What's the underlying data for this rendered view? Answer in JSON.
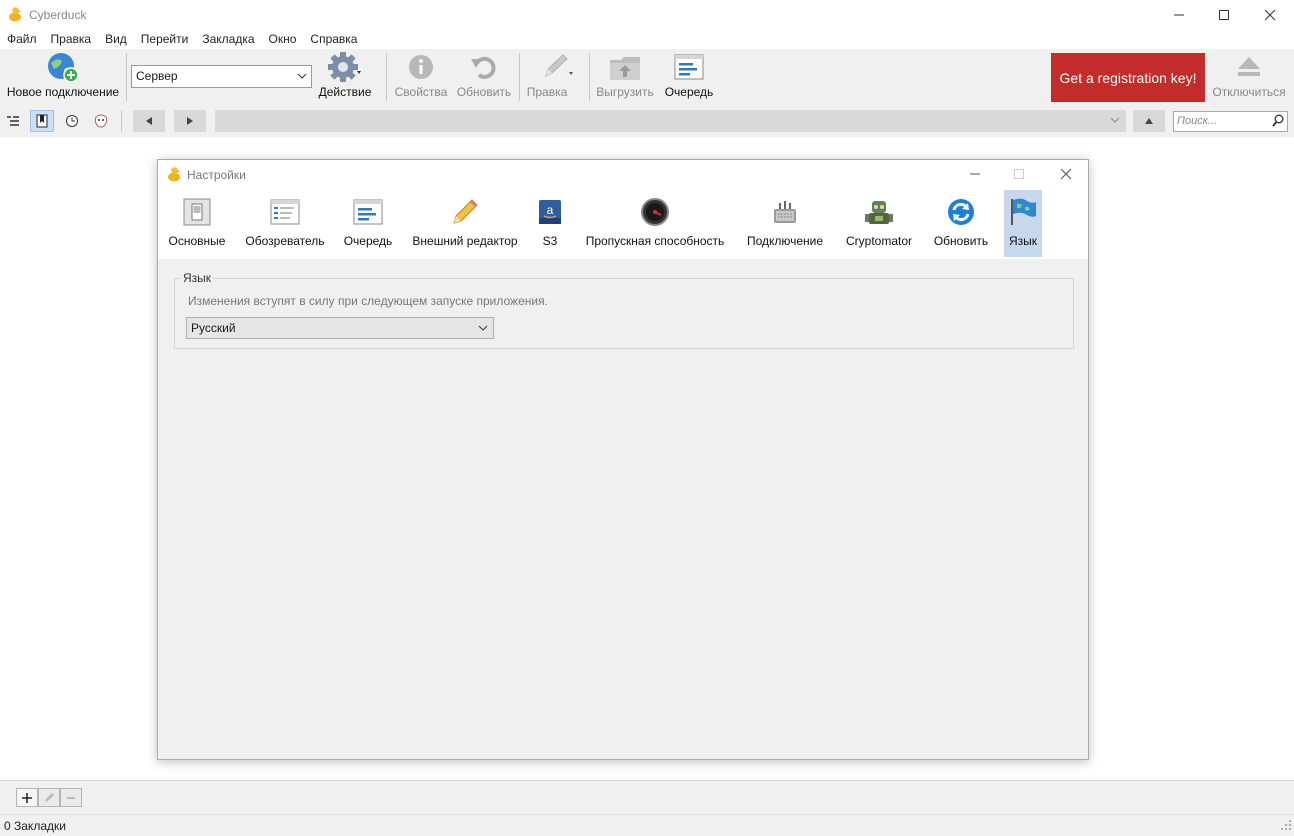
{
  "app": {
    "title": "Cyberduck"
  },
  "menu": [
    "Файл",
    "Правка",
    "Вид",
    "Перейти",
    "Закладка",
    "Окно",
    "Справка"
  ],
  "toolbar": {
    "new_connection": "Новое подключение",
    "server_select": "Сервер",
    "action": "Действие",
    "properties": "Свойства",
    "refresh": "Обновить",
    "edit": "Правка",
    "upload": "Выгрузить",
    "queue": "Очередь",
    "registration": "Get a registration key!",
    "disconnect": "Отключиться"
  },
  "navbar": {
    "search_placeholder": "Поиск..."
  },
  "dialog": {
    "title": "Настройки",
    "tabs": [
      {
        "label": "Основные",
        "icon": "general-switch-icon"
      },
      {
        "label": "Обозреватель",
        "icon": "browser-window-icon"
      },
      {
        "label": "Очередь",
        "icon": "queue-list-icon"
      },
      {
        "label": "Внешний редактор",
        "icon": "pencil-icon"
      },
      {
        "label": "S3",
        "icon": "amazon-s3-icon"
      },
      {
        "label": "Пропускная способность",
        "icon": "bandwidth-gauge-icon"
      },
      {
        "label": "Подключение",
        "icon": "connection-icon"
      },
      {
        "label": "Cryptomator",
        "icon": "cryptomator-robot-icon"
      },
      {
        "label": "Обновить",
        "icon": "update-arrows-icon"
      },
      {
        "label": "Язык",
        "icon": "language-flag-icon"
      }
    ],
    "selected_tab": "Язык",
    "language": {
      "group_label": "Язык",
      "note": "Изменения вступят в силу при следующем запуске приложения.",
      "selected": "Русский"
    }
  },
  "bottom": {
    "status": "0 Закладки"
  },
  "colors": {
    "registration_bg": "#c42b2b",
    "selected_tab_bg": "#c6d7ee",
    "chrome_bg": "#f0f0f0"
  }
}
